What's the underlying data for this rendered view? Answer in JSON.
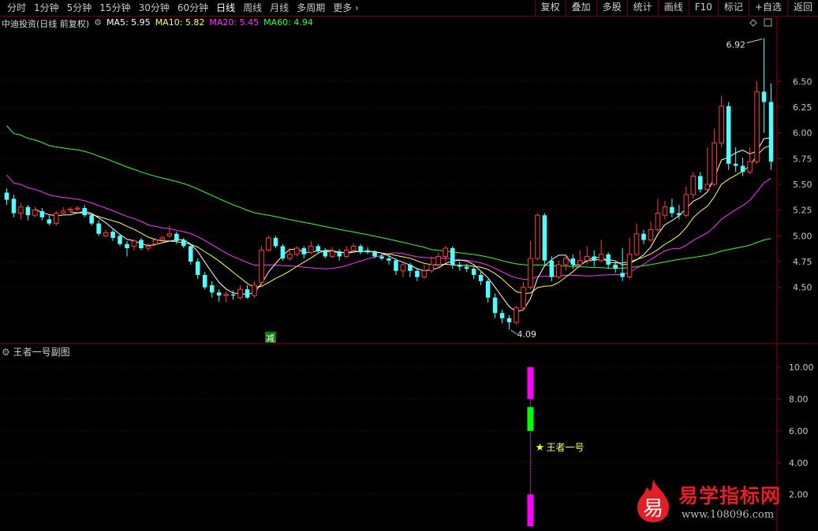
{
  "toolbar": {
    "periods": [
      "分时",
      "1分钟",
      "5分钟",
      "15分钟",
      "30分钟",
      "60分钟",
      "日线",
      "周线",
      "月线",
      "多周期",
      "更多"
    ],
    "active_period": "日线",
    "right": [
      "复权",
      "叠加",
      "多股",
      "统计",
      "画线",
      "F10",
      "标记",
      "+自选",
      "返回"
    ]
  },
  "stock": {
    "title": "中迪投资(日线 前复权)",
    "ma": [
      {
        "label": "MA5: 5.95",
        "color": "#ffffff"
      },
      {
        "label": "MA10: 5.82",
        "color": "#ffff55"
      },
      {
        "label": "MA20: 5.45",
        "color": "#ff33ff"
      },
      {
        "label": "MA60: 4.94",
        "color": "#33ff33"
      }
    ]
  },
  "subchart": {
    "title": "王者一号副图",
    "signal_label": "王者一号"
  },
  "watermark": {
    "name": "易学指标网",
    "url": "www.108096.com",
    "logo_char": "易"
  },
  "chart_data": [
    {
      "type": "candlestick",
      "ylim": [
        4.0,
        7.0
      ],
      "y_ticks": [
        4.5,
        4.75,
        5.0,
        5.25,
        5.5,
        5.75,
        6.0,
        6.25,
        6.5
      ],
      "annotations": {
        "high": "6.92",
        "low": "4.09",
        "signal": "减"
      },
      "candles": [
        [
          5.42,
          5.35,
          5.46,
          5.3
        ],
        [
          5.36,
          5.22,
          5.4,
          5.18
        ],
        [
          5.22,
          5.28,
          5.32,
          5.16
        ],
        [
          5.28,
          5.2,
          5.3,
          5.15
        ],
        [
          5.2,
          5.25,
          5.28,
          5.18
        ],
        [
          5.24,
          5.18,
          5.27,
          5.15
        ],
        [
          5.16,
          5.12,
          5.2,
          5.1
        ],
        [
          5.12,
          5.22,
          5.24,
          5.1
        ],
        [
          5.22,
          5.24,
          5.28,
          5.2
        ],
        [
          5.25,
          5.26,
          5.28,
          5.22
        ],
        [
          5.26,
          5.27,
          5.29,
          5.24
        ],
        [
          5.27,
          5.2,
          5.3,
          5.18
        ],
        [
          5.2,
          5.12,
          5.22,
          5.1
        ],
        [
          5.12,
          5.02,
          5.15,
          5.0
        ],
        [
          5.0,
          5.03,
          5.06,
          4.98
        ],
        [
          5.04,
          4.98,
          5.06,
          4.95
        ],
        [
          5.0,
          4.92,
          5.02,
          4.9
        ],
        [
          4.92,
          4.88,
          4.95,
          4.8
        ],
        [
          4.9,
          4.95,
          4.97,
          4.86
        ],
        [
          4.96,
          4.88,
          4.98,
          4.86
        ],
        [
          4.88,
          4.9,
          4.93,
          4.85
        ],
        [
          4.92,
          4.96,
          4.98,
          4.9
        ],
        [
          4.96,
          4.98,
          5.0,
          4.94
        ],
        [
          5.0,
          5.02,
          5.1,
          4.98
        ],
        [
          5.02,
          4.95,
          5.04,
          4.92
        ],
        [
          4.96,
          4.9,
          4.98,
          4.88
        ],
        [
          4.9,
          4.75,
          4.92,
          4.72
        ],
        [
          4.75,
          4.62,
          4.78,
          4.58
        ],
        [
          4.62,
          4.5,
          4.65,
          4.48
        ],
        [
          4.52,
          4.45,
          4.56,
          4.4
        ],
        [
          4.45,
          4.42,
          4.48,
          4.36
        ],
        [
          4.42,
          4.43,
          4.46,
          4.35
        ],
        [
          4.43,
          4.42,
          4.47,
          4.38
        ],
        [
          4.4,
          4.48,
          4.52,
          4.38
        ],
        [
          4.48,
          4.4,
          4.52,
          4.39
        ],
        [
          4.42,
          4.52,
          4.56,
          4.4
        ],
        [
          4.55,
          4.86,
          4.9,
          4.52
        ],
        [
          4.86,
          4.98,
          5.0,
          4.85
        ],
        [
          4.98,
          4.9,
          5.0,
          4.88
        ],
        [
          4.9,
          4.78,
          4.92,
          4.76
        ],
        [
          4.78,
          4.82,
          4.88,
          4.76
        ],
        [
          4.82,
          4.88,
          4.9,
          4.8
        ],
        [
          4.88,
          4.82,
          4.9,
          4.78
        ],
        [
          4.84,
          4.9,
          4.95,
          4.82
        ],
        [
          4.9,
          4.85,
          4.92,
          4.83
        ],
        [
          4.85,
          4.8,
          4.88,
          4.78
        ],
        [
          4.8,
          4.85,
          4.89,
          4.78
        ],
        [
          4.85,
          4.8,
          4.87,
          4.76
        ],
        [
          4.8,
          4.86,
          4.9,
          4.78
        ],
        [
          4.86,
          4.9,
          4.93,
          4.84
        ],
        [
          4.9,
          4.84,
          4.92,
          4.82
        ],
        [
          4.86,
          4.84,
          4.89,
          4.82
        ],
        [
          4.84,
          4.8,
          4.86,
          4.78
        ],
        [
          4.8,
          4.78,
          4.83,
          4.76
        ],
        [
          4.78,
          4.76,
          4.82,
          4.72
        ],
        [
          4.76,
          4.66,
          4.78,
          4.62
        ],
        [
          4.66,
          4.72,
          4.75,
          4.6
        ],
        [
          4.72,
          4.66,
          4.74,
          4.6
        ],
        [
          4.66,
          4.6,
          4.69,
          4.56
        ],
        [
          4.6,
          4.66,
          4.72,
          4.58
        ],
        [
          4.66,
          4.72,
          4.8,
          4.64
        ],
        [
          4.72,
          4.8,
          4.84,
          4.68
        ],
        [
          4.8,
          4.88,
          4.9,
          4.74
        ],
        [
          4.88,
          4.72,
          4.9,
          4.68
        ],
        [
          4.72,
          4.7,
          4.75,
          4.66
        ],
        [
          4.7,
          4.68,
          4.73,
          4.65
        ],
        [
          4.68,
          4.62,
          4.7,
          4.58
        ],
        [
          4.62,
          4.56,
          4.65,
          4.52
        ],
        [
          4.56,
          4.4,
          4.58,
          4.35
        ],
        [
          4.4,
          4.25,
          4.44,
          4.2
        ],
        [
          4.25,
          4.2,
          4.28,
          4.15
        ],
        [
          4.2,
          4.16,
          4.23,
          4.09
        ],
        [
          4.16,
          4.3,
          4.32,
          4.14
        ],
        [
          4.3,
          4.5,
          4.55,
          4.28
        ],
        [
          4.5,
          4.78,
          4.95,
          4.48
        ],
        [
          4.78,
          5.2,
          5.22,
          4.76
        ],
        [
          5.2,
          4.76,
          5.22,
          4.72
        ],
        [
          4.76,
          4.6,
          4.8,
          4.56
        ],
        [
          4.6,
          4.72,
          4.76,
          4.58
        ],
        [
          4.72,
          4.78,
          4.82,
          4.66
        ],
        [
          4.78,
          4.72,
          4.82,
          4.68
        ],
        [
          4.72,
          4.76,
          4.86,
          4.7
        ],
        [
          4.76,
          4.8,
          4.9,
          4.72
        ],
        [
          4.8,
          4.76,
          4.86,
          4.7
        ],
        [
          4.76,
          4.82,
          4.96,
          4.74
        ],
        [
          4.82,
          4.72,
          4.84,
          4.68
        ],
        [
          4.72,
          4.68,
          4.76,
          4.64
        ],
        [
          4.64,
          4.6,
          4.88,
          4.56
        ],
        [
          4.6,
          4.82,
          4.98,
          4.58
        ],
        [
          4.82,
          5.02,
          5.12,
          4.8
        ],
        [
          5.02,
          4.96,
          5.06,
          4.92
        ],
        [
          4.96,
          5.06,
          5.14,
          4.94
        ],
        [
          5.06,
          5.22,
          5.36,
          5.04
        ],
        [
          5.2,
          5.28,
          5.34,
          5.16
        ],
        [
          5.28,
          5.22,
          5.36,
          5.18
        ],
        [
          5.22,
          5.2,
          5.3,
          5.16
        ],
        [
          5.2,
          5.4,
          5.48,
          5.18
        ],
        [
          5.4,
          5.58,
          5.62,
          5.36
        ],
        [
          5.58,
          5.45,
          5.62,
          5.42
        ],
        [
          5.45,
          5.5,
          5.86,
          5.44
        ],
        [
          5.5,
          5.9,
          6.04,
          5.48
        ],
        [
          5.9,
          6.26,
          6.36,
          5.86
        ],
        [
          6.26,
          5.7,
          6.3,
          5.64
        ],
        [
          5.7,
          5.68,
          5.86,
          5.62
        ],
        [
          5.68,
          5.62,
          5.76,
          5.58
        ],
        [
          5.62,
          5.72,
          5.86,
          5.6
        ],
        [
          5.72,
          6.4,
          6.5,
          5.7
        ],
        [
          6.4,
          6.3,
          6.92,
          6.0
        ],
        [
          6.3,
          5.72,
          6.48,
          5.64
        ]
      ]
    },
    {
      "type": "bar",
      "title": "王者一号副图",
      "ylim": [
        0,
        10.8
      ],
      "y_ticks": [
        2.0,
        4.0,
        6.0,
        8.0,
        10.0
      ],
      "signal_bar_index": 74,
      "segments": [
        {
          "from": 0,
          "to": 2,
          "color": "#ff00ff"
        },
        {
          "from": 6.0,
          "to": 7.5,
          "color": "#00ff00"
        },
        {
          "from": 8.0,
          "to": 10.0,
          "color": "#ff00ff"
        }
      ]
    }
  ]
}
